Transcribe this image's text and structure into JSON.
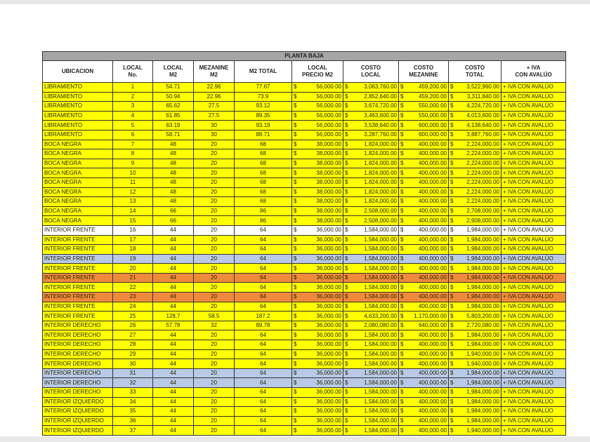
{
  "title": "PLANTA BAJA",
  "headers": [
    "UBICACION",
    "LOCAL\nNo.",
    "LOCAL\nM2",
    "MEZANINE\nM2",
    "M2 TOTAL",
    "LOCAL\nPRECIO M2",
    "COSTO\nLOCAL",
    "COSTO\nMEZANINE",
    "COSTO\nTOTAL",
    "+ IVA\nCON AVALÚO"
  ],
  "currency": "$",
  "colors": {
    "yellow": "#ffff00",
    "white": "#ffffff",
    "blue": "#b9c9e6",
    "orange": "#ef8a3c",
    "header": "#a6a6a6"
  },
  "rows": [
    {
      "ub": "LIBRAMIENTO",
      "no": "1",
      "m2": "54.71",
      "mez": "22.96",
      "tot": "77.67",
      "precio": "56,000.00",
      "local": "3,063,760.00",
      "cmez": "459,200.00",
      "ctot": "3,522,960.00",
      "iva": "+ IVA CON AVALÚO",
      "color": "yellow"
    },
    {
      "ub": "LIBRAMIENTO",
      "no": "2",
      "m2": "50.94",
      "mez": "22.96",
      "tot": "73.9",
      "precio": "56,000.00",
      "local": "2,852,640.00",
      "cmez": "459,200.00",
      "ctot": "3,311,840.00",
      "iva": "+ IVA CON AVALÚO",
      "color": "yellow"
    },
    {
      "ub": "LIBRAMIENTO",
      "no": "3",
      "m2": "65.62",
      "mez": "27.5",
      "tot": "93.12",
      "precio": "56,000.00",
      "local": "3,674,720.00",
      "cmez": "550,000.00",
      "ctot": "4,224,720.00",
      "iva": "+ IVA CON AVALÚO",
      "color": "yellow"
    },
    {
      "ub": "LIBRAMIENTO",
      "no": "4",
      "m2": "61.85",
      "mez": "27.5",
      "tot": "89.35",
      "precio": "56,000.00",
      "local": "3,463,600.00",
      "cmez": "550,000.00",
      "ctot": "4,013,600.00",
      "iva": "+ IVA CON AVALÚO",
      "color": "yellow"
    },
    {
      "ub": "LIBRAMIENTO",
      "no": "5",
      "m2": "63.19",
      "mez": "30",
      "tot": "93.19",
      "precio": "56,000.00",
      "local": "3,538,640.00",
      "cmez": "600,000.00",
      "ctot": "4,138,640.00",
      "iva": "+ IVA CON AVALÚO",
      "color": "yellow"
    },
    {
      "ub": "LIBRAMIENTO",
      "no": "6",
      "m2": "58.71",
      "mez": "30",
      "tot": "88.71",
      "precio": "56,000.00",
      "local": "3,287,760.00",
      "cmez": "600,000.00",
      "ctot": "3,887,760.00",
      "iva": "+ IVA CON AVALÚO",
      "color": "yellow"
    },
    {
      "ub": "BOCA NEGRA",
      "no": "7",
      "m2": "48",
      "mez": "20",
      "tot": "68",
      "precio": "38,000.00",
      "local": "1,824,000.00",
      "cmez": "400,000.00",
      "ctot": "2,224,000.00",
      "iva": "+ IVA CON AVALÚO",
      "color": "yellow"
    },
    {
      "ub": "BOCA NEGRA",
      "no": "8",
      "m2": "48",
      "mez": "20",
      "tot": "68",
      "precio": "38,000.00",
      "local": "1,824,000.00",
      "cmez": "400,000.00",
      "ctot": "2,224,000.00",
      "iva": "+ IVA CON AVALÚO",
      "color": "yellow"
    },
    {
      "ub": "BOCA NEGRA",
      "no": "9",
      "m2": "48",
      "mez": "20",
      "tot": "68",
      "precio": "38,000.00",
      "local": "1,824,000.00",
      "cmez": "400,000.00",
      "ctot": "2,224,000.00",
      "iva": "+ IVA CON AVALÚO",
      "color": "yellow"
    },
    {
      "ub": "BOCA NEGRA",
      "no": "10",
      "m2": "48",
      "mez": "20",
      "tot": "68",
      "precio": "38,000.00",
      "local": "1,824,000.00",
      "cmez": "400,000.00",
      "ctot": "2,224,000.00",
      "iva": "+ IVA CON AVALÚO",
      "color": "yellow"
    },
    {
      "ub": "BOCA NEGRA",
      "no": "11",
      "m2": "48",
      "mez": "20",
      "tot": "68",
      "precio": "38,000.00",
      "local": "1,824,000.00",
      "cmez": "400,000.00",
      "ctot": "2,224,000.00",
      "iva": "+ IVA CON AVALÚO",
      "color": "yellow"
    },
    {
      "ub": "BOCA NEGRA",
      "no": "12",
      "m2": "48",
      "mez": "20",
      "tot": "68",
      "precio": "38,000.00",
      "local": "1,824,000.00",
      "cmez": "400,000.00",
      "ctot": "2,224,000.00",
      "iva": "+ IVA CON AVALÚO",
      "color": "yellow"
    },
    {
      "ub": "BOCA NEGRA",
      "no": "13",
      "m2": "48",
      "mez": "20",
      "tot": "68",
      "precio": "38,000.00",
      "local": "1,824,000.00",
      "cmez": "400,000.00",
      "ctot": "2,224,000.00",
      "iva": "+ IVA CON AVALÚO",
      "color": "yellow"
    },
    {
      "ub": "BOCA NEGRA",
      "no": "14",
      "m2": "66",
      "mez": "20",
      "tot": "86",
      "precio": "38,000.00",
      "local": "2,508,000.00",
      "cmez": "400,000.00",
      "ctot": "2,708,000.00",
      "iva": "+ IVA CON AVALÚO",
      "color": "yellow"
    },
    {
      "ub": "BOCA NEGRA",
      "no": "15",
      "m2": "66",
      "mez": "20",
      "tot": "86",
      "precio": "38,000.00",
      "local": "2,508,000.00",
      "cmez": "400,000.00",
      "ctot": "2,908,000.00",
      "iva": "+ IVA CON AVALÚO",
      "color": "yellow"
    },
    {
      "ub": "INTERIOR FRENTE",
      "no": "16",
      "m2": "44",
      "mez": "20",
      "tot": "64",
      "precio": "36,000.00",
      "local": "1,584,000.00",
      "cmez": "400,000.00",
      "ctot": "1,984,000.00",
      "iva": "+ IVA CON AVALÚO",
      "color": "white"
    },
    {
      "ub": "INTERIOR FRENTE",
      "no": "17",
      "m2": "44",
      "mez": "20",
      "tot": "64",
      "precio": "36,000.00",
      "local": "1,584,000.00",
      "cmez": "400,000.00",
      "ctot": "1,984,000.00",
      "iva": "+ IVA CON AVALÚO",
      "color": "yellow"
    },
    {
      "ub": "INTERIOR FRENTE",
      "no": "18",
      "m2": "44",
      "mez": "20",
      "tot": "64",
      "precio": "36,000.00",
      "local": "1,584,000.00",
      "cmez": "400,000.00",
      "ctot": "1,984,000.00",
      "iva": "+ IVA CON AVALÚO",
      "color": "yellow"
    },
    {
      "ub": "INTERIOR FRENTE",
      "no": "19",
      "m2": "44",
      "mez": "20",
      "tot": "64",
      "precio": "36,000.00",
      "local": "1,584,000.00",
      "cmez": "400,000.00",
      "ctot": "1,984,000.00",
      "iva": "+ IVA CON AVALÚO",
      "color": "blue"
    },
    {
      "ub": "INTERIOR FRENTE",
      "no": "20",
      "m2": "44",
      "mez": "20",
      "tot": "64",
      "precio": "36,000.00",
      "local": "1,584,000.00",
      "cmez": "400,000.00",
      "ctot": "1,984,000.00",
      "iva": "+ IVA CON AVALÚO",
      "color": "yellow"
    },
    {
      "ub": "INTERIOR FRENTE",
      "no": "21",
      "m2": "44",
      "mez": "20",
      "tot": "64",
      "precio": "36,000.00",
      "local": "1,584,000.00",
      "cmez": "400,000.00",
      "ctot": "1,984,000.00",
      "iva": "+ IVA CON AVALÚO",
      "color": "orange"
    },
    {
      "ub": "INTERIOR FRENTE",
      "no": "22",
      "m2": "44",
      "mez": "20",
      "tot": "64",
      "precio": "36,000.00",
      "local": "1,584,000.00",
      "cmez": "400,000.00",
      "ctot": "1,984,000.00",
      "iva": "+ IVA CON AVALÚO",
      "color": "yellow"
    },
    {
      "ub": "INTERIOR FRENTE",
      "no": "23",
      "m2": "44",
      "mez": "20",
      "tot": "64",
      "precio": "36,000.00",
      "local": "1,584,000.00",
      "cmez": "400,000.00",
      "ctot": "1,984,000.00",
      "iva": "+ IVA CON AVALÚO",
      "color": "orange"
    },
    {
      "ub": "INTERIOR FRENTE",
      "no": "24",
      "m2": "44",
      "mez": "20",
      "tot": "64",
      "precio": "36,000.00",
      "local": "1,584,000.00",
      "cmez": "400,000.00",
      "ctot": "1,984,000.00",
      "iva": "+ IVA CON AVALÚO",
      "color": "yellow"
    },
    {
      "ub": "INTERIOR FRENTE",
      "no": "25",
      "m2": "128.7",
      "mez": "58.5",
      "tot": "187.2",
      "precio": "36,000.00",
      "local": "4,633,200.00",
      "cmez": "1,170,000.00",
      "ctot": "5,803,200.00",
      "iva": "+ IVA CON AVALÚO",
      "color": "yellow"
    },
    {
      "ub": "INTERIOR DERECHO",
      "no": "26",
      "m2": "57.78",
      "mez": "32",
      "tot": "89.78",
      "precio": "36,000.00",
      "local": "2,080,080.00",
      "cmez": "640,000.00",
      "ctot": "2,720,080.00",
      "iva": "+ IVA CON AVALÚO",
      "color": "yellow"
    },
    {
      "ub": "INTERIOR DERECHO",
      "no": "27",
      "m2": "44",
      "mez": "20",
      "tot": "64",
      "precio": "36,000.00",
      "local": "1,584,000.00",
      "cmez": "400,000.00",
      "ctot": "1,984,000.00",
      "iva": "+ IVA CON AVALÚO",
      "color": "yellow"
    },
    {
      "ub": "INTERIOR DERECHO",
      "no": "28",
      "m2": "44",
      "mez": "20",
      "tot": "64",
      "precio": "36,000.00",
      "local": "1,584,000.00",
      "cmez": "400,000.00",
      "ctot": "1,984,000.00",
      "iva": "+ IVA CON AVALÚO",
      "color": "yellow"
    },
    {
      "ub": "INTERIOR DERECHO",
      "no": "29",
      "m2": "44",
      "mez": "20",
      "tot": "64",
      "precio": "36,000.00",
      "local": "1,584,000.00",
      "cmez": "400,000.00",
      "ctot": "1,940,000.00",
      "iva": "+ IVA CON AVALÚO",
      "color": "yellow"
    },
    {
      "ub": "INTERIOR DERECHO",
      "no": "30",
      "m2": "44",
      "mez": "20",
      "tot": "64",
      "precio": "36,000.00",
      "local": "1,584,000.00",
      "cmez": "400,000.00",
      "ctot": "1,940,000.00",
      "iva": "+ IVA CON AVALÚO",
      "color": "yellow"
    },
    {
      "ub": "INTERIOR DERECHO",
      "no": "31",
      "m2": "44",
      "mez": "20",
      "tot": "64",
      "precio": "36,000.00",
      "local": "1,584,000.00",
      "cmez": "400,000.00",
      "ctot": "1,984,000.00",
      "iva": "+ IVA CON AVALÚO",
      "color": "blue"
    },
    {
      "ub": "INTERIOR DERECHO",
      "no": "32",
      "m2": "44",
      "mez": "20",
      "tot": "64",
      "precio": "36,000.00",
      "local": "1,584,000.00",
      "cmez": "400,000.00",
      "ctot": "1,984,000.00",
      "iva": "+ IVA CON AVALÚO",
      "color": "blue"
    },
    {
      "ub": "INTERIOR DERECHO",
      "no": "33",
      "m2": "44",
      "mez": "20",
      "tot": "64",
      "precio": "36,000.00",
      "local": "1,584,000.00",
      "cmez": "400,000.00",
      "ctot": "1,984,000.00",
      "iva": "+ IVA CON AVALÚO",
      "color": "yellow"
    },
    {
      "ub": "INTERIOR IZQUIERDO",
      "no": "34",
      "m2": "44",
      "mez": "20",
      "tot": "64",
      "precio": "36,000.00",
      "local": "1,584,000.00",
      "cmez": "400,000.00",
      "ctot": "1,984,000.00",
      "iva": "+ IVA CON AVALÚO",
      "color": "yellow"
    },
    {
      "ub": "INTERIOR IZQUIERDO",
      "no": "35",
      "m2": "44",
      "mez": "20",
      "tot": "64",
      "precio": "36,000.00",
      "local": "1,584,000.00",
      "cmez": "400,000.00",
      "ctot": "1,984,000.00",
      "iva": "+ IVA CON AVALÚO",
      "color": "yellow"
    },
    {
      "ub": "INTERIOR IZQUIERDO",
      "no": "36",
      "m2": "44",
      "mez": "20",
      "tot": "64",
      "precio": "36,000.00",
      "local": "1,584,000.00",
      "cmez": "400,000.00",
      "ctot": "1,984,000.00",
      "iva": "+ IVA CON AVALÚO",
      "color": "yellow"
    },
    {
      "ub": "INTERIOR IZQUIERDO",
      "no": "37",
      "m2": "44",
      "mez": "20",
      "tot": "64",
      "precio": "36,000.00",
      "local": "1,584,000.00",
      "cmez": "400,000.00",
      "ctot": "1,940,000.00",
      "iva": "+ IVA CON AVALÚO",
      "color": "yellow"
    }
  ]
}
